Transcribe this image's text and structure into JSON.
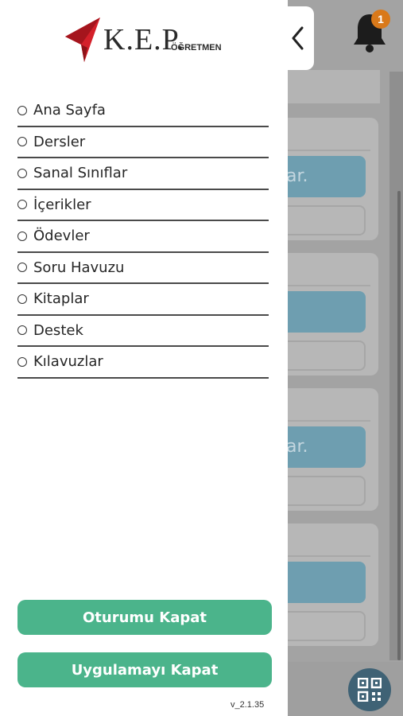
{
  "brand": {
    "name": "K.E.P.",
    "subtitle": "ÖĞRETMEN",
    "accent_color": "#d4202a"
  },
  "header": {
    "back_icon": "chevron-left-icon",
    "notification_count": "1"
  },
  "menu": {
    "items": [
      {
        "label": "Ana Sayfa"
      },
      {
        "label": "Dersler"
      },
      {
        "label": "Sanal Sınıflar"
      },
      {
        "label": "İçerikler"
      },
      {
        "label": "Ödevler"
      },
      {
        "label": "Soru Havuzu"
      },
      {
        "label": "Kitaplar"
      },
      {
        "label": "Destek"
      },
      {
        "label": "Kılavuzlar"
      }
    ]
  },
  "actions": {
    "logout_label": "Oturumu Kapat",
    "close_app_label": "Uygulamayı Kapat",
    "button_color": "#4bb48b"
  },
  "version": "v_2.1.35",
  "background": {
    "card_text": "ar."
  }
}
